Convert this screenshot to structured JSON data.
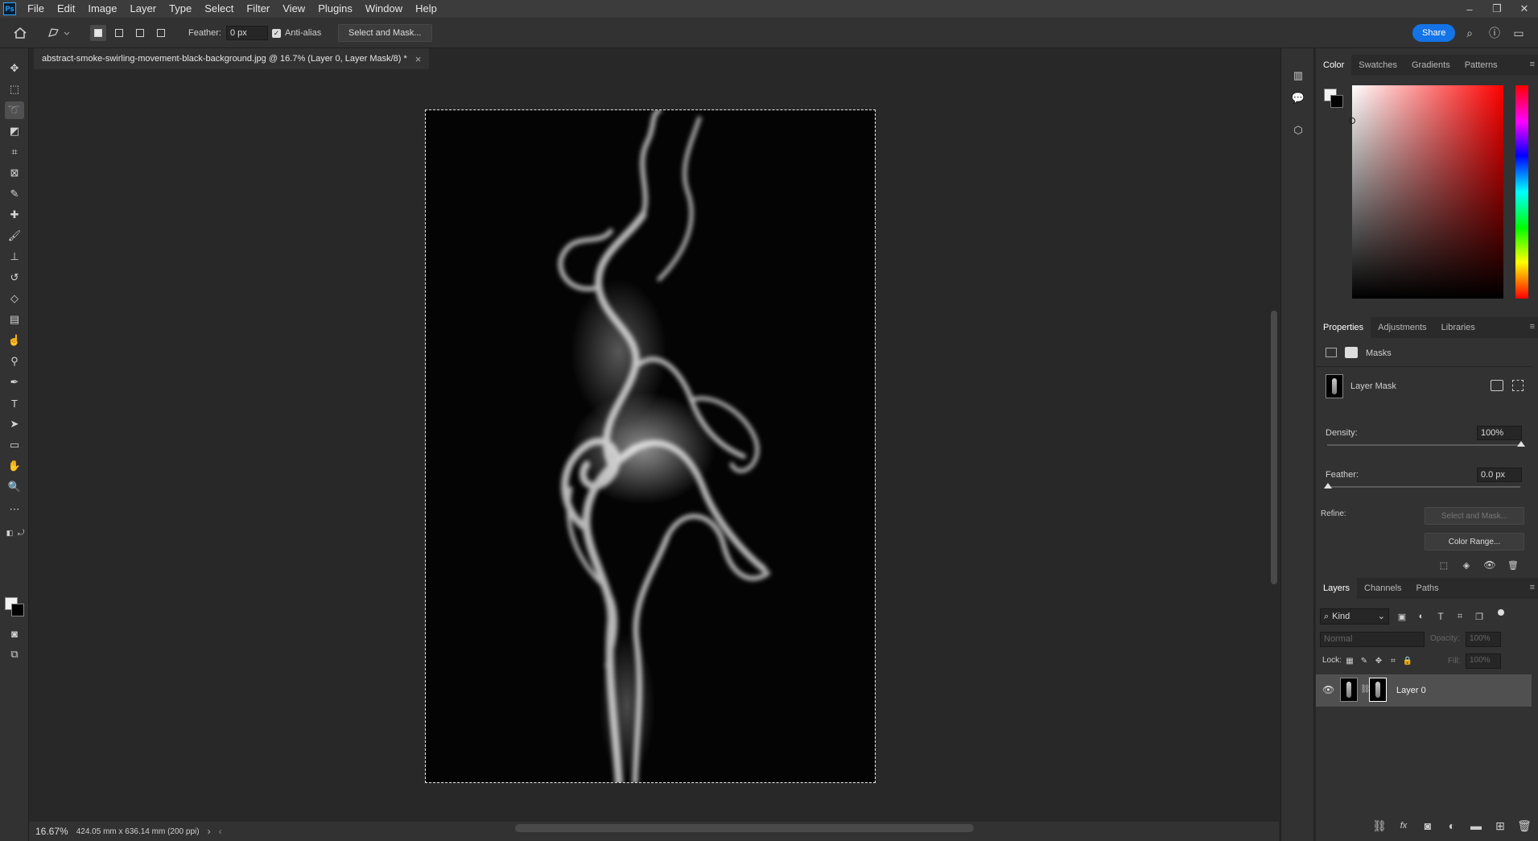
{
  "menubar": {
    "logo": "Ps",
    "items": [
      "File",
      "Edit",
      "Image",
      "Layer",
      "Type",
      "Select",
      "Filter",
      "View",
      "Plugins",
      "Window",
      "Help"
    ],
    "window_controls": [
      "–",
      "❐",
      "✕"
    ]
  },
  "options": {
    "feather_label": "Feather:",
    "feather_value": "0 px",
    "antialias_label": "Anti-alias",
    "select_mask_label": "Select and Mask...",
    "share_label": "Share"
  },
  "document": {
    "tab_title": "abstract-smoke-swirling-movement-black-background.jpg @ 16.7% (Layer 0, Layer Mask/8) *",
    "close": "×"
  },
  "status": {
    "zoom": "16.67%",
    "doc_info": "424.05 mm x 636.14 mm (200 ppi)",
    "arrow": "›",
    "left_arrow": "‹"
  },
  "color_panel": {
    "tabs": [
      "Color",
      "Swatches",
      "Gradients",
      "Patterns"
    ],
    "fg_color": "#f2f2f2",
    "bg_color": "#000000"
  },
  "properties_panel": {
    "tabs": [
      "Properties",
      "Adjustments",
      "Libraries"
    ],
    "section_label": "Masks",
    "mask_label": "Layer Mask",
    "density_label": "Density:",
    "density_value": "100%",
    "feather_label": "Feather:",
    "feather_value": "0.0 px",
    "refine_label": "Refine:",
    "select_mask_label": "Select and Mask...",
    "color_range_label": "Color Range..."
  },
  "layers_panel": {
    "tabs": [
      "Layers",
      "Channels",
      "Paths"
    ],
    "filter_label": "Kind",
    "blend_mode": "Normal",
    "opacity_label": "Opacity:",
    "opacity_value": "100%",
    "lock_label": "Lock:",
    "fill_label": "Fill:",
    "fill_value": "100%",
    "layers": [
      {
        "name": "Layer 0"
      }
    ]
  },
  "accent_colors": {
    "share_button": "#1473e6",
    "selected_layer": "#505050"
  }
}
